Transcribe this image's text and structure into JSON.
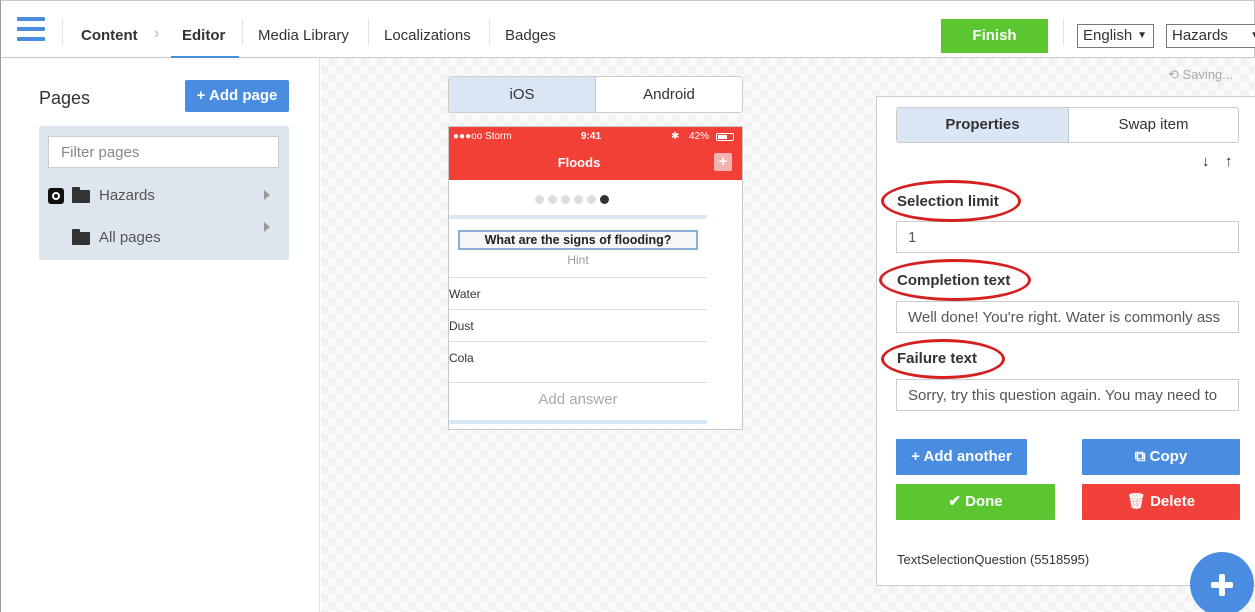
{
  "nav": {
    "content": "Content",
    "editor": "Editor",
    "media_library": "Media Library",
    "localizations": "Localizations",
    "badges": "Badges",
    "finish": "Finish",
    "language": "English",
    "app": "Hazards"
  },
  "pages_panel": {
    "title": "Pages",
    "add_page": "+ Add page",
    "filter_placeholder": "Filter pages",
    "tree": [
      {
        "label": "Hazards"
      },
      {
        "label": "All pages"
      }
    ]
  },
  "preview": {
    "platforms": [
      "iOS",
      "Android"
    ],
    "selected_platform": "iOS",
    "status": {
      "carrier": "●●●oo Storm",
      "time": "9:41",
      "battery": "42%"
    },
    "title": "Floods",
    "plus": "+",
    "question": "What are the signs of flooding?",
    "hint": "Hint",
    "answers": [
      "Water",
      "Dust",
      "Cola"
    ],
    "add_answer": "Add answer",
    "page_dots": 6,
    "current_dot": 6
  },
  "properties": {
    "saving": "Saving...",
    "tabs": [
      "Properties",
      "Swap item"
    ],
    "selected_tab": "Properties",
    "down": "↓",
    "up": "↑",
    "selection_limit_label": "Selection limit",
    "selection_limit_value": "1",
    "completion_text_label": "Completion text",
    "completion_text_value": "Well done! You're right. Water is commonly ass",
    "failure_text_label": "Failure text",
    "failure_text_value": "Sorry, try this question again. You may need to",
    "add_another": "+ Add another",
    "copy": "⧉ Copy",
    "done": "✔ Done",
    "delete": "🗑 Delete",
    "type_label": "TextSelectionQuestion (5518595)"
  },
  "colors": {
    "accent": "#4a8de0",
    "success": "#5cc630",
    "danger": "#f2413a",
    "phone_bar": "#f24037",
    "annotation": "#d62020"
  }
}
